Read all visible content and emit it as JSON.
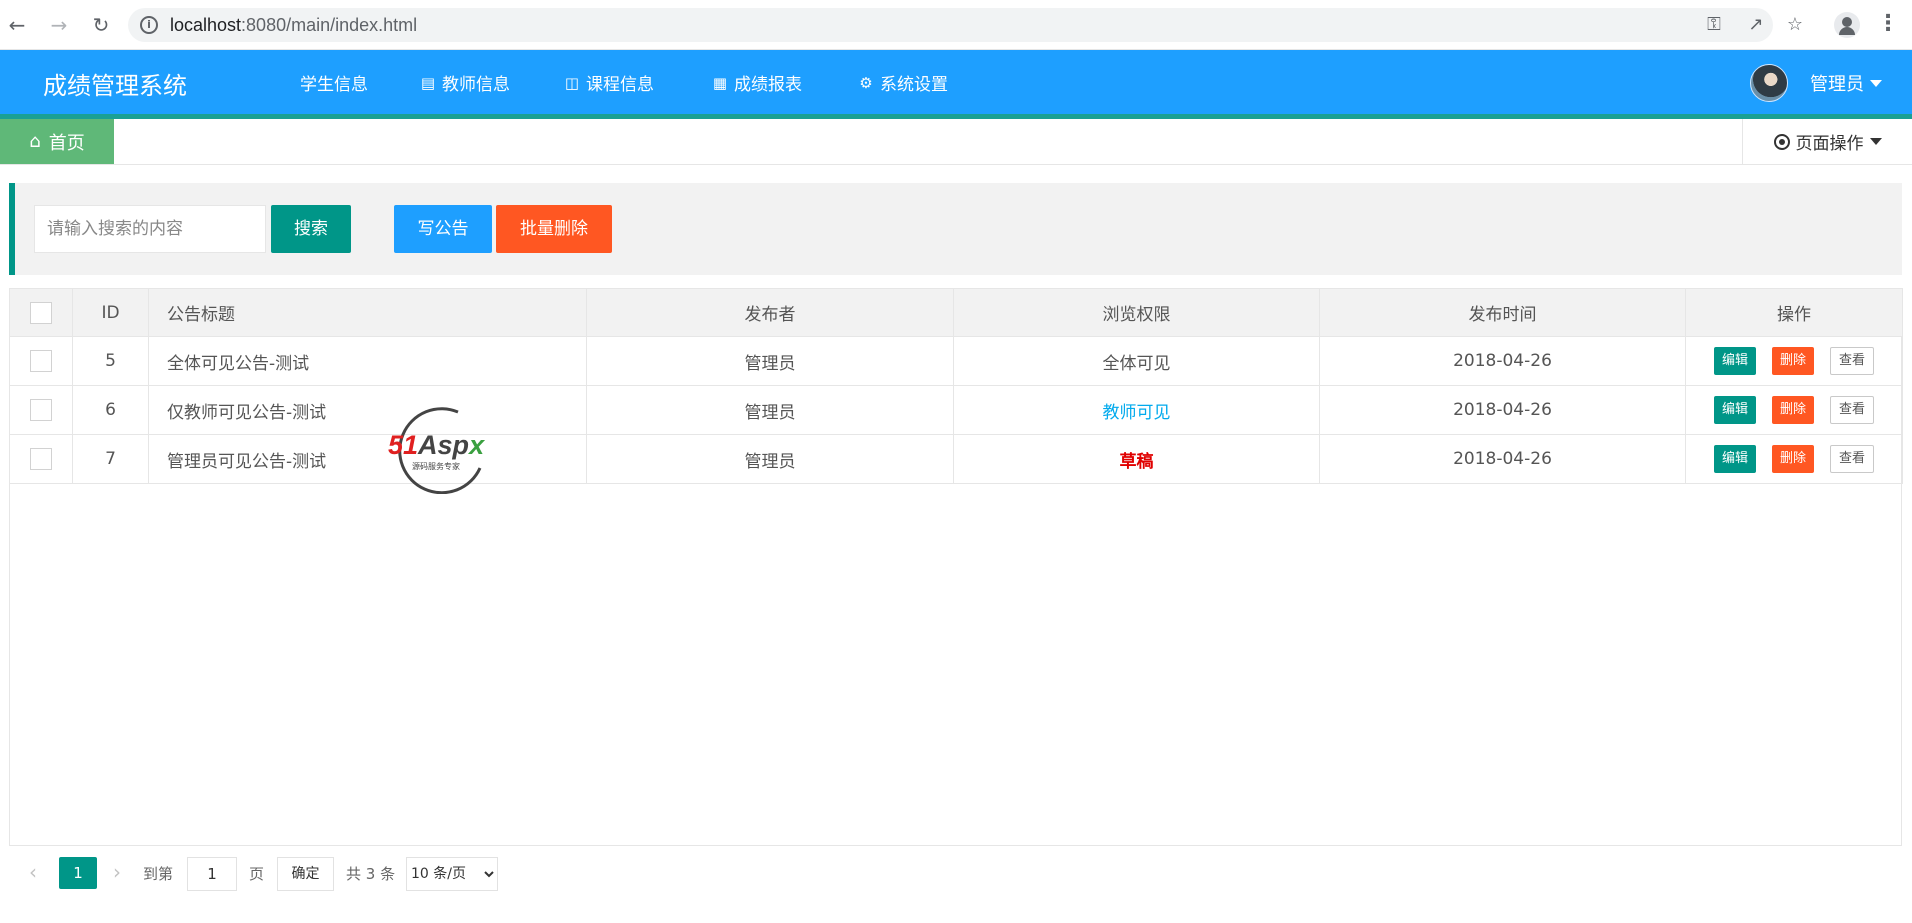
{
  "browser": {
    "url_host": "localhost",
    "url_rest": ":8080/main/index.html",
    "back_icon": "arrow-left-icon",
    "forward_icon": "arrow-right-icon",
    "reload_icon": "reload-icon"
  },
  "header": {
    "brand": "成绩管理系统",
    "nav": [
      {
        "label": "学生信息",
        "icon": ""
      },
      {
        "label": "教师信息",
        "icon": "clipboard-icon"
      },
      {
        "label": "课程信息",
        "icon": "book-icon"
      },
      {
        "label": "成绩报表",
        "icon": "grid-icon"
      },
      {
        "label": "系统设置",
        "icon": "gear-icon"
      }
    ],
    "user": "管理员"
  },
  "tabs": {
    "home": "首页",
    "page_ops": "页面操作"
  },
  "toolbar": {
    "search_placeholder": "请输入搜索的内容",
    "search_label": "搜索",
    "write_label": "写公告",
    "batch_delete_label": "批量删除"
  },
  "table": {
    "headers": [
      "ID",
      "公告标题",
      "发布者",
      "浏览权限",
      "发布时间",
      "操作"
    ],
    "rows": [
      {
        "id": "5",
        "title": "全体可见公告-测试",
        "publisher": "管理员",
        "permission": "全体可见",
        "date": "2018-04-26"
      },
      {
        "id": "6",
        "title": "仅教师可见公告-测试",
        "publisher": "管理员",
        "permission": "教师可见",
        "date": "2018-04-26"
      },
      {
        "id": "7",
        "title": "管理员可见公告-测试",
        "publisher": "管理员",
        "permission": "草稿",
        "date": "2018-04-26"
      }
    ],
    "actions": {
      "edit": "编辑",
      "delete": "删除",
      "view": "查看"
    }
  },
  "pager": {
    "current": "1",
    "goto_prefix": "到第",
    "goto_value": "1",
    "goto_suffix": "页",
    "confirm": "确定",
    "total": "共 3 条",
    "page_size": "10 条/页"
  },
  "watermark": {
    "brand": "51Aspx",
    "tagline": "源码服务专家"
  },
  "colors": {
    "header": "#1e9fff",
    "primary_green": "#009688",
    "home_tab": "#5fb878",
    "danger": "#ff5722",
    "teacher_permission": "#01aaed",
    "draft": "#e00000"
  }
}
